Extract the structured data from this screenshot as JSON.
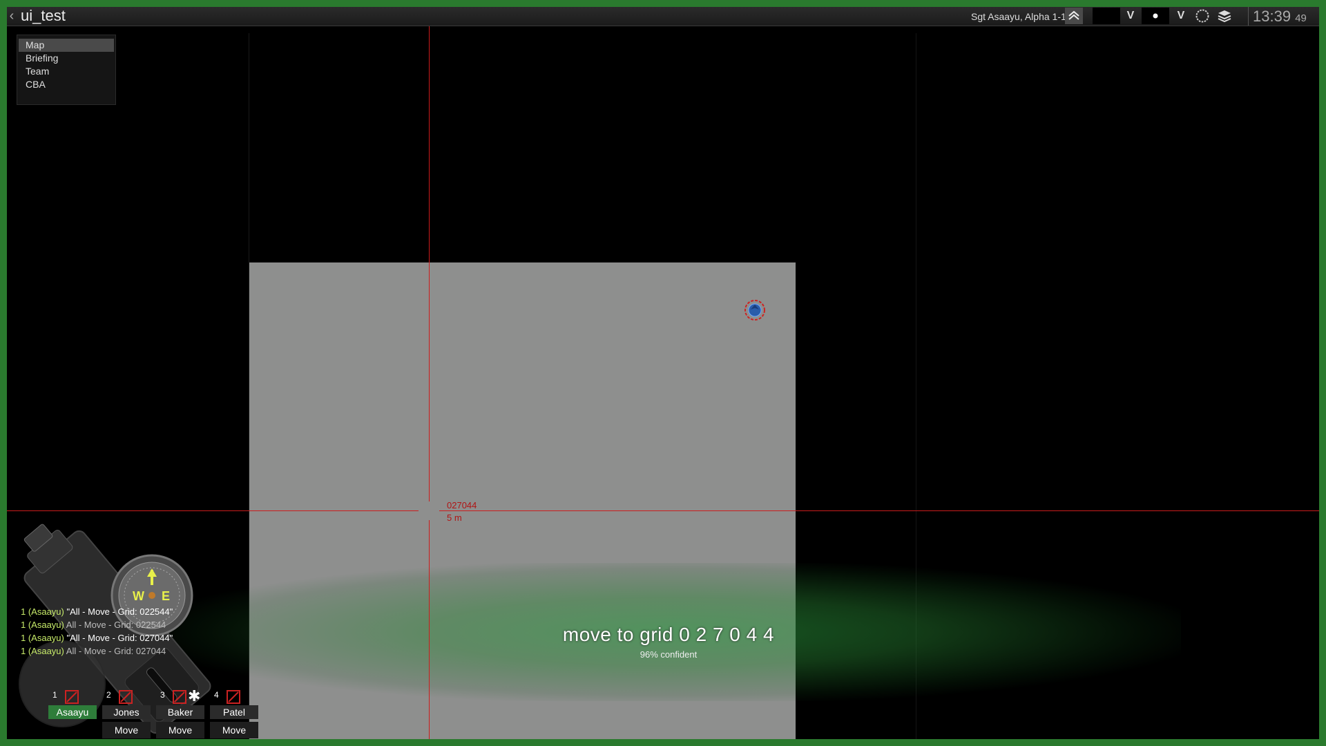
{
  "window": {
    "title": "ui_test"
  },
  "topbar": {
    "player": "Sgt Asaayu, Alpha 1-1 1",
    "v_label_1": "V",
    "v_label_2": "V",
    "clock_hm": "13:39",
    "clock_s": "49"
  },
  "menu": {
    "items": [
      "Map",
      "Briefing",
      "Team",
      "CBA"
    ]
  },
  "map": {
    "grid": "027044",
    "distance": "5 m",
    "colors": {
      "crosshair": "#cc1c1c",
      "terrain": "#8e8f8e",
      "frame": "#2a7a2e"
    }
  },
  "command": {
    "text": "move to grid 0 2 7 0 4 4",
    "confidence": "96% confident"
  },
  "compass": {
    "w": "W",
    "e": "E"
  },
  "chat": [
    {
      "sender": "1 (Asaayu)",
      "text": "\"All - Move - Grid: 022544\"",
      "style": "quoted"
    },
    {
      "sender": "1 (Asaayu)",
      "text": "All - Move - Grid: 022544",
      "style": "plain"
    },
    {
      "sender": "1 (Asaayu)",
      "text": "\"All - Move - Grid: 027044\"",
      "style": "quoted"
    },
    {
      "sender": "1 (Asaayu)",
      "text": "All - Move - Grid: 027044",
      "style": "plain"
    }
  ],
  "team": [
    {
      "num": "1",
      "name": "Asaayu",
      "order": ""
    },
    {
      "num": "2",
      "name": "Jones",
      "order": "Move"
    },
    {
      "num": "3",
      "name": "Baker",
      "order": "Move"
    },
    {
      "num": "4",
      "name": "Patel",
      "order": "Move"
    }
  ]
}
